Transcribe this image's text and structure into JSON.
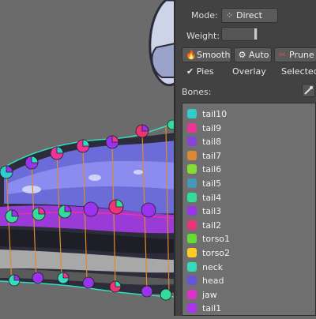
{
  "panel": {
    "mode_label": "Mode:",
    "mode_value": "Direct",
    "weight_label": "Weight:",
    "buttons": {
      "smooth": "Smooth",
      "auto": "Auto",
      "prune": "Prune"
    },
    "toggles": {
      "pies": "Pies",
      "pies_check": "✔",
      "overlay": "Overlay",
      "selected": "Selected"
    },
    "bones_label": "Bones:",
    "bones": [
      {
        "name": "tail10",
        "color": "#33cccc"
      },
      {
        "name": "tail9",
        "color": "#ee3399"
      },
      {
        "name": "tail8",
        "color": "#8844dd"
      },
      {
        "name": "tail7",
        "color": "#dd8833"
      },
      {
        "name": "tail6",
        "color": "#88dd33"
      },
      {
        "name": "tail5",
        "color": "#4499bb"
      },
      {
        "name": "tail4",
        "color": "#33dd99"
      },
      {
        "name": "tail3",
        "color": "#9933ee"
      },
      {
        "name": "tail2",
        "color": "#ee3377"
      },
      {
        "name": "torso1",
        "color": "#66dd33"
      },
      {
        "name": "torso2",
        "color": "#ffcc22"
      },
      {
        "name": "neck",
        "color": "#33ddbb"
      },
      {
        "name": "head",
        "color": "#6655dd"
      },
      {
        "name": "jaw",
        "color": "#dd33cc"
      },
      {
        "name": "tail1",
        "color": "#aa33ee"
      }
    ]
  },
  "colors": {
    "panel_bg": "#424242",
    "list_bg": "#6f6f6f",
    "viewport_bg": "#6b6b6b"
  }
}
